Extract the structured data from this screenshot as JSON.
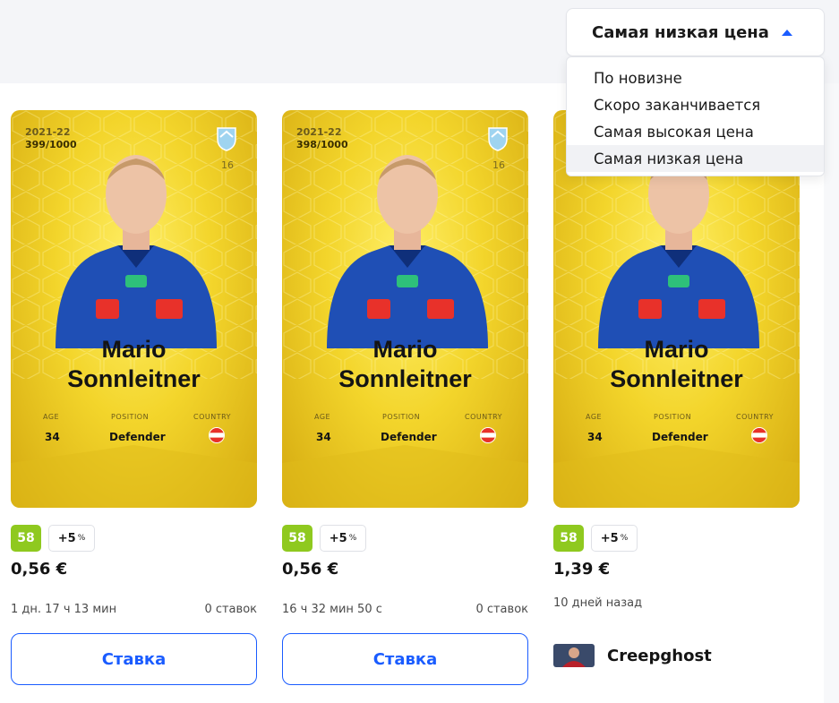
{
  "sort": {
    "current_label": "Самая низкая цена",
    "options": [
      "По новизне",
      "Скоро заканчивается",
      "Самая высокая цена",
      "Самая низкая цена"
    ],
    "selected_index": 3
  },
  "colors": {
    "accent": "#1a5cff",
    "score_badge": "#8fc91f",
    "card_gold": "#f3d52b"
  },
  "cards": [
    {
      "season": "2021-22",
      "serial": "399/1000",
      "number": "16",
      "first_name": "Mario",
      "last_name": "Sonnleitner",
      "age_label": "AGE",
      "position_label": "POSITION",
      "country_label": "COUNTRY",
      "age": "34",
      "position": "Defender",
      "country_flag": "austria-flag",
      "score": "58",
      "bonus": "+5",
      "bonus_unit": "%",
      "price": "0,56 €",
      "time_left": "1 дн. 17 ч 13 мин",
      "bids": "0 ставок",
      "bid_label": "Ставка"
    },
    {
      "season": "2021-22",
      "serial": "398/1000",
      "number": "16",
      "first_name": "Mario",
      "last_name": "Sonnleitner",
      "age_label": "AGE",
      "position_label": "POSITION",
      "country_label": "COUNTRY",
      "age": "34",
      "position": "Defender",
      "country_flag": "austria-flag",
      "score": "58",
      "bonus": "+5",
      "bonus_unit": "%",
      "price": "0,56 €",
      "time_left": "16 ч 32 мин 50 с",
      "bids": "0 ставок",
      "bid_label": "Ставка"
    },
    {
      "first_name": "Mario",
      "last_name": "Sonnleitner",
      "age_label": "AGE",
      "position_label": "POSITION",
      "country_label": "COUNTRY",
      "age": "34",
      "position": "Defender",
      "country_flag": "austria-flag",
      "score": "58",
      "bonus": "+5",
      "bonus_unit": "%",
      "price": "1,39 €",
      "sold_time": "10 дней назад",
      "buyer_name": "Creepghost"
    }
  ]
}
